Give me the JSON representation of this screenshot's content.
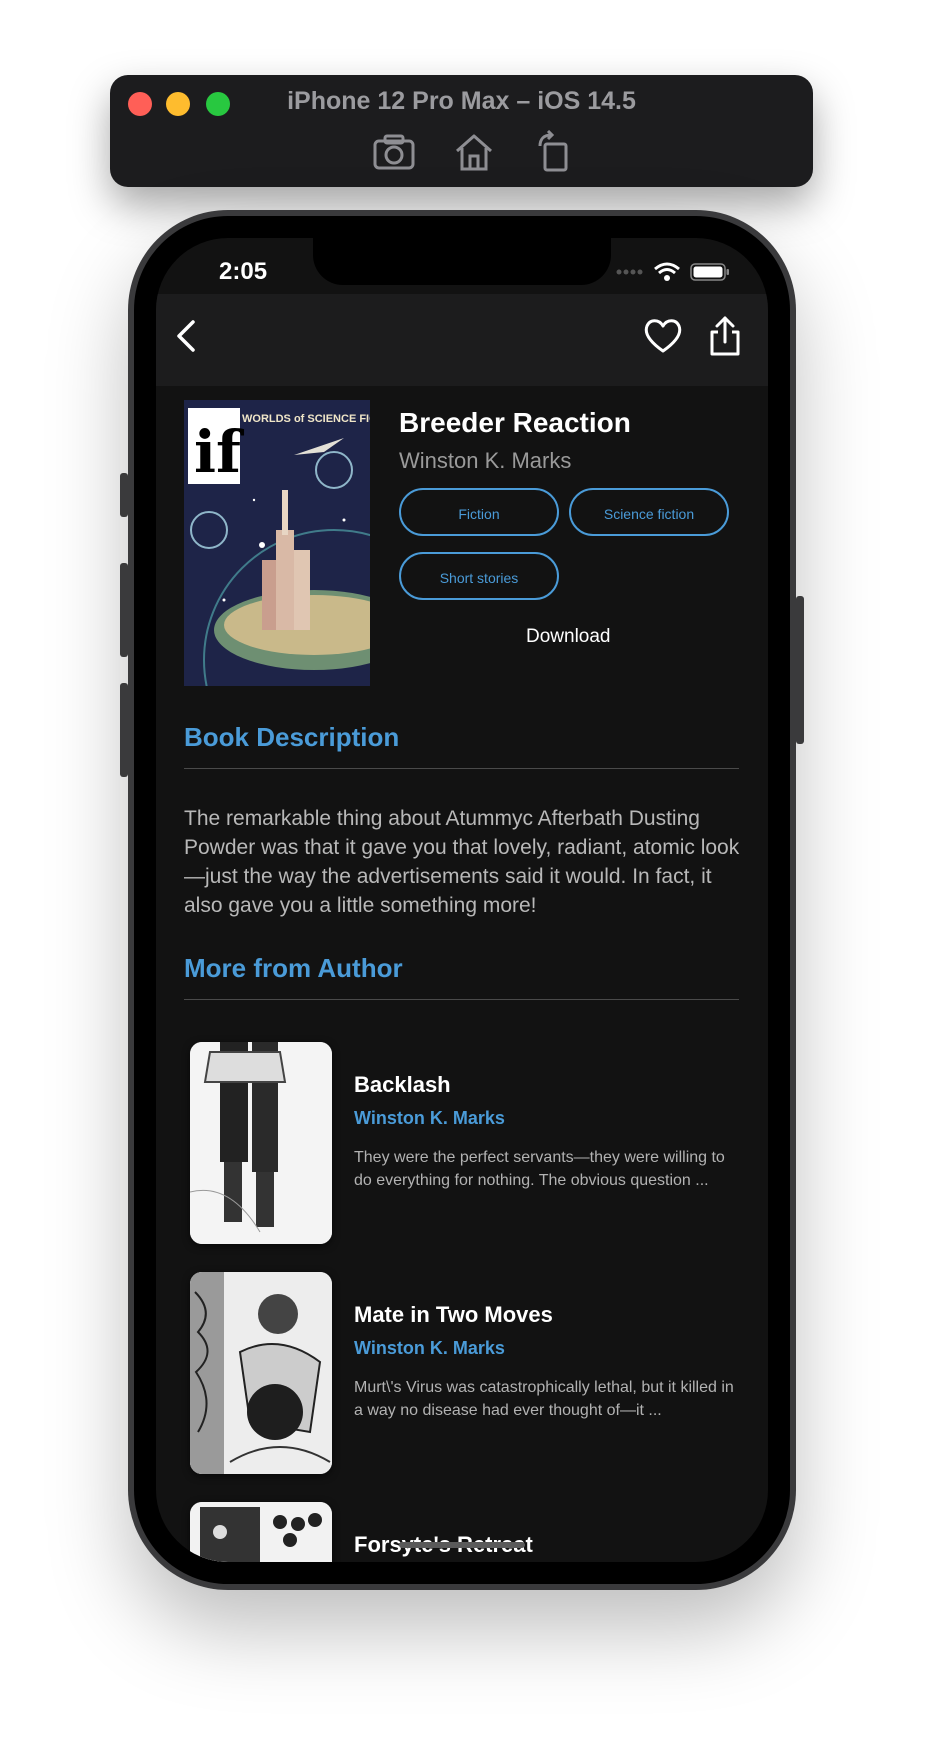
{
  "simulator": {
    "title": "iPhone 12 Pro Max – iOS 14.5",
    "tools": [
      "camera-icon",
      "home-icon",
      "rotate-icon"
    ]
  },
  "status_bar": {
    "time": "2:05"
  },
  "book": {
    "title": "Breeder Reaction",
    "author": "Winston K. Marks",
    "tags": [
      "Fiction",
      "Science fiction",
      "Short stories"
    ],
    "download_label": "Download",
    "cover_text": "WORLDS of SCIENCE FICTION"
  },
  "description": {
    "heading": "Book Description",
    "text": "The remarkable thing about Atummyc Afterbath Dusting Powder was that it gave you that lovely, radiant, atomic look—just the way the advertisements said it would. In fact, it also gave you a little something more!"
  },
  "more_from_author": {
    "heading": "More from Author",
    "items": [
      {
        "title": "Backlash",
        "author": "Winston K. Marks",
        "description": "They were the perfect servants—they were willing to do everything for nothing. The obvious question ..."
      },
      {
        "title": "Mate in Two Moves",
        "author": "Winston K. Marks",
        "description": "Murt\\'s Virus was catastrophically lethal, but it killed in a way no disease had ever thought of—it ..."
      },
      {
        "title": "Forsyte's Retreat",
        "author": "",
        "description": ""
      }
    ]
  },
  "colors": {
    "accent": "#4a9bd8",
    "background": "#121212",
    "navbar": "#1c1c1d"
  }
}
